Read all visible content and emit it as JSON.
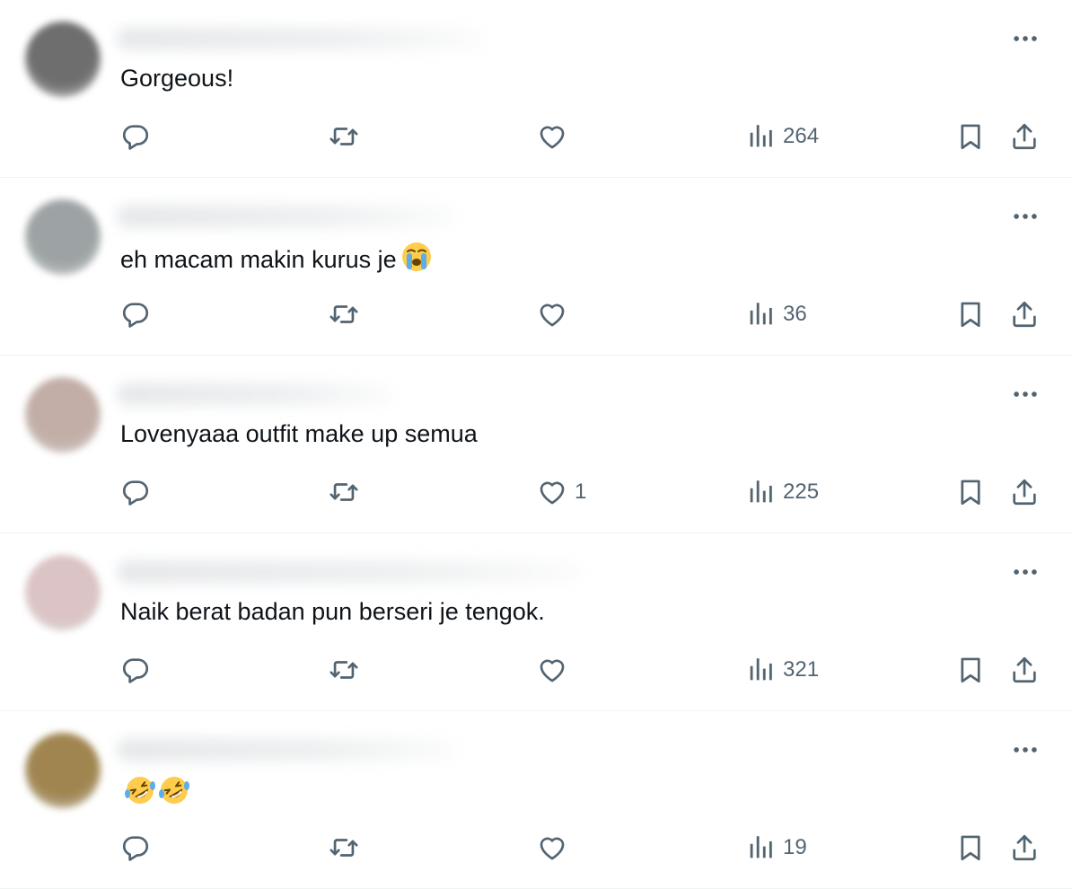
{
  "replies": [
    {
      "text": "Gorgeous!",
      "emojis": [],
      "reply_count": "",
      "repost_count": "",
      "like_count": "",
      "view_count": "264",
      "avatar_color": "#6e6e6e",
      "name_blur_width": 410
    },
    {
      "text": "eh macam makin kurus je",
      "emojis": [
        "loudly-crying-face"
      ],
      "reply_count": "",
      "repost_count": "",
      "like_count": "",
      "view_count": "36",
      "avatar_color": "#9da3a4",
      "name_blur_width": 380
    },
    {
      "text": "Lovenyaaa outfit make up semua",
      "emojis": [],
      "reply_count": "",
      "repost_count": "",
      "like_count": "1",
      "view_count": "225",
      "avatar_color": "#c2aea6",
      "name_blur_width": 310
    },
    {
      "text": "Naik berat badan pun berseri je tengok.",
      "emojis": [],
      "reply_count": "",
      "repost_count": "",
      "like_count": "",
      "view_count": "321",
      "avatar_color": "#dcc3c5",
      "name_blur_width": 520
    },
    {
      "text": "",
      "emojis": [
        "rolling-on-floor-laughing",
        "rolling-on-floor-laughing"
      ],
      "reply_count": "",
      "repost_count": "",
      "like_count": "",
      "view_count": "19",
      "avatar_color": "#a08550",
      "name_blur_width": 380
    }
  ],
  "icons": {
    "reply": "reply-icon",
    "repost": "repost-icon",
    "like": "heart-icon",
    "views": "views-icon",
    "bookmark": "bookmark-icon",
    "share": "share-icon",
    "more": "more-icon"
  },
  "colors": {
    "icon": "#536471",
    "text": "#0f1419",
    "divider": "#eff3f4"
  }
}
